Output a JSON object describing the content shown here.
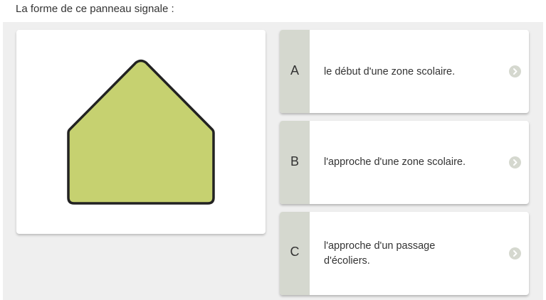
{
  "question": {
    "text": "La forme de ce panneau signale :"
  },
  "sign": {
    "fill_color": "#c6d170",
    "stroke_color": "#222222",
    "shape": "pentagon-icon"
  },
  "answers": [
    {
      "letter": "A",
      "text": "le début d'une zone scolaire."
    },
    {
      "letter": "B",
      "text": "l'approche d'une zone scolaire."
    },
    {
      "letter": "C",
      "text": "l'approche d'un passage d'écoliers."
    }
  ],
  "colors": {
    "content_background": "#efefef",
    "letter_box": "#d5d8cf",
    "arrow_icon": "#d5d8cf"
  }
}
